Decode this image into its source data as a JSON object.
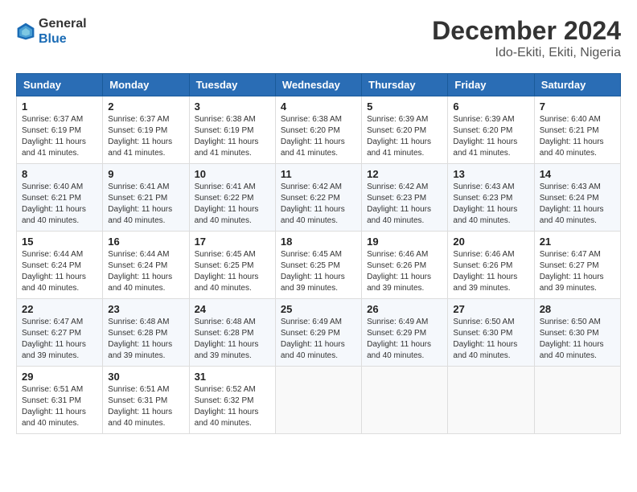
{
  "header": {
    "logo_general": "General",
    "logo_blue": "Blue",
    "month_title": "December 2024",
    "location": "Ido-Ekiti, Ekiti, Nigeria"
  },
  "weekdays": [
    "Sunday",
    "Monday",
    "Tuesday",
    "Wednesday",
    "Thursday",
    "Friday",
    "Saturday"
  ],
  "weeks": [
    [
      {
        "day": "1",
        "info": "Sunrise: 6:37 AM\nSunset: 6:19 PM\nDaylight: 11 hours and 41 minutes."
      },
      {
        "day": "2",
        "info": "Sunrise: 6:37 AM\nSunset: 6:19 PM\nDaylight: 11 hours and 41 minutes."
      },
      {
        "day": "3",
        "info": "Sunrise: 6:38 AM\nSunset: 6:19 PM\nDaylight: 11 hours and 41 minutes."
      },
      {
        "day": "4",
        "info": "Sunrise: 6:38 AM\nSunset: 6:20 PM\nDaylight: 11 hours and 41 minutes."
      },
      {
        "day": "5",
        "info": "Sunrise: 6:39 AM\nSunset: 6:20 PM\nDaylight: 11 hours and 41 minutes."
      },
      {
        "day": "6",
        "info": "Sunrise: 6:39 AM\nSunset: 6:20 PM\nDaylight: 11 hours and 41 minutes."
      },
      {
        "day": "7",
        "info": "Sunrise: 6:40 AM\nSunset: 6:21 PM\nDaylight: 11 hours and 40 minutes."
      }
    ],
    [
      {
        "day": "8",
        "info": "Sunrise: 6:40 AM\nSunset: 6:21 PM\nDaylight: 11 hours and 40 minutes."
      },
      {
        "day": "9",
        "info": "Sunrise: 6:41 AM\nSunset: 6:21 PM\nDaylight: 11 hours and 40 minutes."
      },
      {
        "day": "10",
        "info": "Sunrise: 6:41 AM\nSunset: 6:22 PM\nDaylight: 11 hours and 40 minutes."
      },
      {
        "day": "11",
        "info": "Sunrise: 6:42 AM\nSunset: 6:22 PM\nDaylight: 11 hours and 40 minutes."
      },
      {
        "day": "12",
        "info": "Sunrise: 6:42 AM\nSunset: 6:23 PM\nDaylight: 11 hours and 40 minutes."
      },
      {
        "day": "13",
        "info": "Sunrise: 6:43 AM\nSunset: 6:23 PM\nDaylight: 11 hours and 40 minutes."
      },
      {
        "day": "14",
        "info": "Sunrise: 6:43 AM\nSunset: 6:24 PM\nDaylight: 11 hours and 40 minutes."
      }
    ],
    [
      {
        "day": "15",
        "info": "Sunrise: 6:44 AM\nSunset: 6:24 PM\nDaylight: 11 hours and 40 minutes."
      },
      {
        "day": "16",
        "info": "Sunrise: 6:44 AM\nSunset: 6:24 PM\nDaylight: 11 hours and 40 minutes."
      },
      {
        "day": "17",
        "info": "Sunrise: 6:45 AM\nSunset: 6:25 PM\nDaylight: 11 hours and 40 minutes."
      },
      {
        "day": "18",
        "info": "Sunrise: 6:45 AM\nSunset: 6:25 PM\nDaylight: 11 hours and 39 minutes."
      },
      {
        "day": "19",
        "info": "Sunrise: 6:46 AM\nSunset: 6:26 PM\nDaylight: 11 hours and 39 minutes."
      },
      {
        "day": "20",
        "info": "Sunrise: 6:46 AM\nSunset: 6:26 PM\nDaylight: 11 hours and 39 minutes."
      },
      {
        "day": "21",
        "info": "Sunrise: 6:47 AM\nSunset: 6:27 PM\nDaylight: 11 hours and 39 minutes."
      }
    ],
    [
      {
        "day": "22",
        "info": "Sunrise: 6:47 AM\nSunset: 6:27 PM\nDaylight: 11 hours and 39 minutes."
      },
      {
        "day": "23",
        "info": "Sunrise: 6:48 AM\nSunset: 6:28 PM\nDaylight: 11 hours and 39 minutes."
      },
      {
        "day": "24",
        "info": "Sunrise: 6:48 AM\nSunset: 6:28 PM\nDaylight: 11 hours and 39 minutes."
      },
      {
        "day": "25",
        "info": "Sunrise: 6:49 AM\nSunset: 6:29 PM\nDaylight: 11 hours and 40 minutes."
      },
      {
        "day": "26",
        "info": "Sunrise: 6:49 AM\nSunset: 6:29 PM\nDaylight: 11 hours and 40 minutes."
      },
      {
        "day": "27",
        "info": "Sunrise: 6:50 AM\nSunset: 6:30 PM\nDaylight: 11 hours and 40 minutes."
      },
      {
        "day": "28",
        "info": "Sunrise: 6:50 AM\nSunset: 6:30 PM\nDaylight: 11 hours and 40 minutes."
      }
    ],
    [
      {
        "day": "29",
        "info": "Sunrise: 6:51 AM\nSunset: 6:31 PM\nDaylight: 11 hours and 40 minutes."
      },
      {
        "day": "30",
        "info": "Sunrise: 6:51 AM\nSunset: 6:31 PM\nDaylight: 11 hours and 40 minutes."
      },
      {
        "day": "31",
        "info": "Sunrise: 6:52 AM\nSunset: 6:32 PM\nDaylight: 11 hours and 40 minutes."
      },
      {
        "day": "",
        "info": ""
      },
      {
        "day": "",
        "info": ""
      },
      {
        "day": "",
        "info": ""
      },
      {
        "day": "",
        "info": ""
      }
    ]
  ]
}
